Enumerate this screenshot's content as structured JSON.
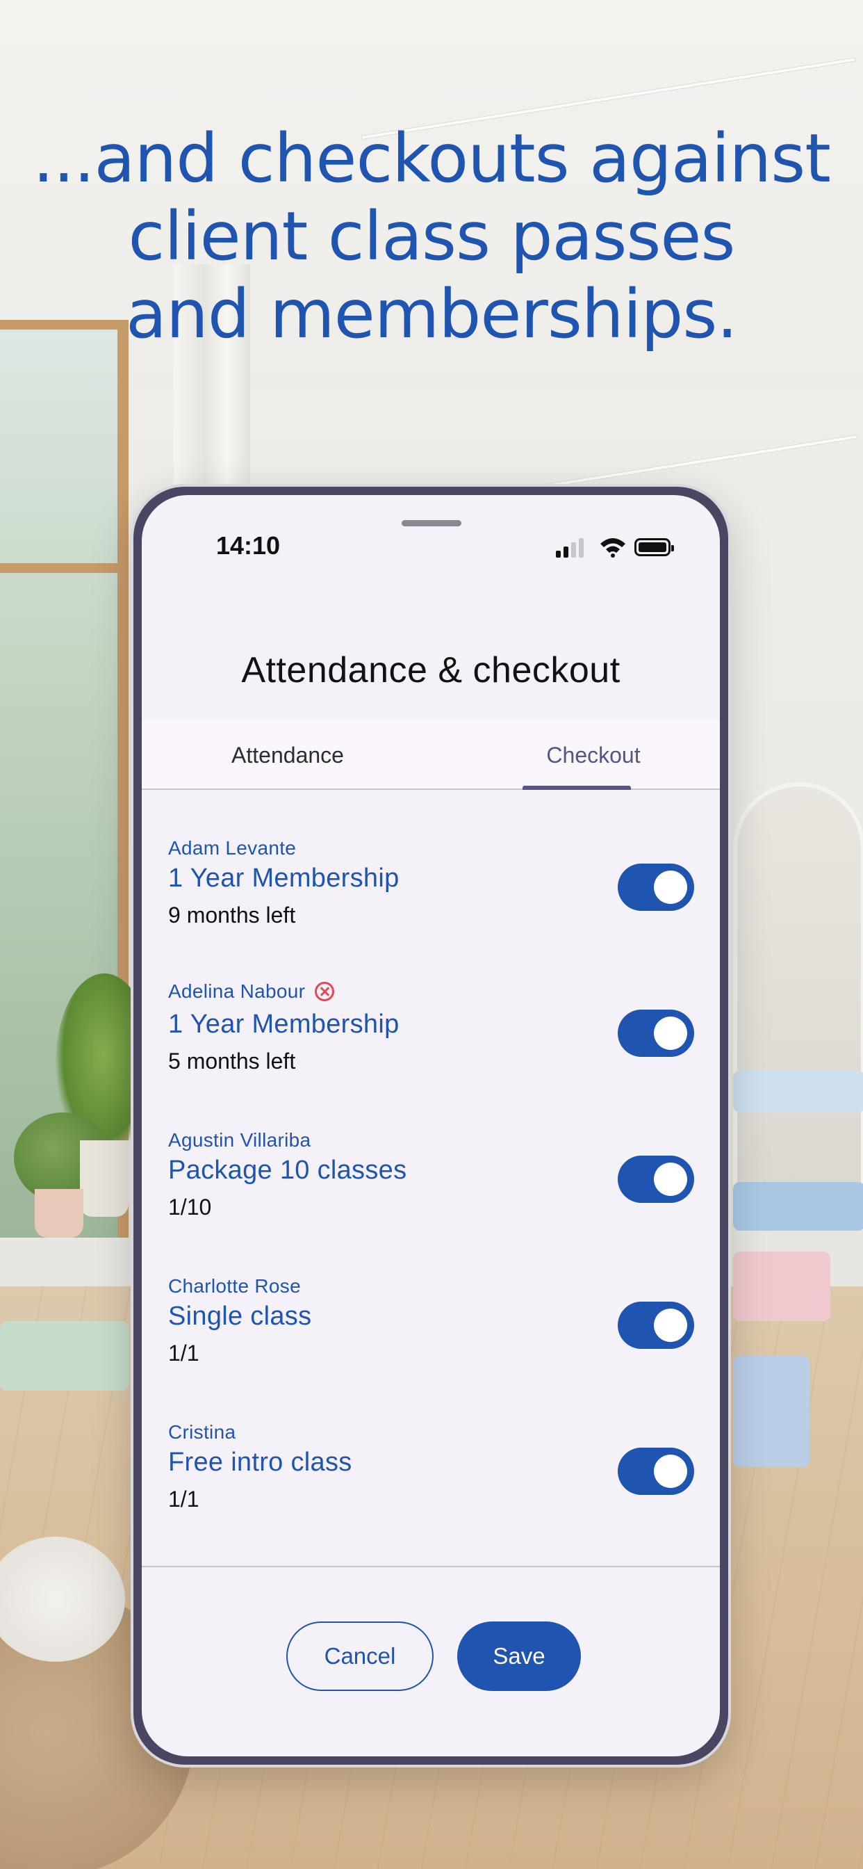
{
  "headline": {
    "line1": "...and checkouts against",
    "line2": "client class passes",
    "line3": "and memberships."
  },
  "status_bar": {
    "time": "14:10"
  },
  "screen": {
    "title": "Attendance & checkout",
    "tabs": [
      {
        "label": "Attendance",
        "selected": false
      },
      {
        "label": "Checkout",
        "selected": true
      }
    ]
  },
  "checkout_items": [
    {
      "client": "Adam Levante",
      "plan": "1 Year Membership",
      "remaining": "9 months left",
      "checked_out": true,
      "flag_icon": null
    },
    {
      "client": "Adelina Nabour",
      "plan": "1 Year Membership",
      "remaining": "5 months left",
      "checked_out": true,
      "flag_icon": "cancel-circle-icon"
    },
    {
      "client": "Agustin Villariba",
      "plan": "Package 10 classes",
      "remaining": "1/10",
      "checked_out": true,
      "flag_icon": null
    },
    {
      "client": "Charlotte Rose",
      "plan": "Single class",
      "remaining": "1/1",
      "checked_out": true,
      "flag_icon": null
    },
    {
      "client": "Cristina",
      "plan": "Free intro class",
      "remaining": "1/1",
      "checked_out": true,
      "flag_icon": null
    }
  ],
  "actions": {
    "cancel_label": "Cancel",
    "save_label": "Save"
  },
  "colors": {
    "brand_blue": "#1f54b0",
    "tab_active": "#5a5386",
    "screen_bg": "#f5f1f9",
    "alert_red": "#e24a57"
  }
}
